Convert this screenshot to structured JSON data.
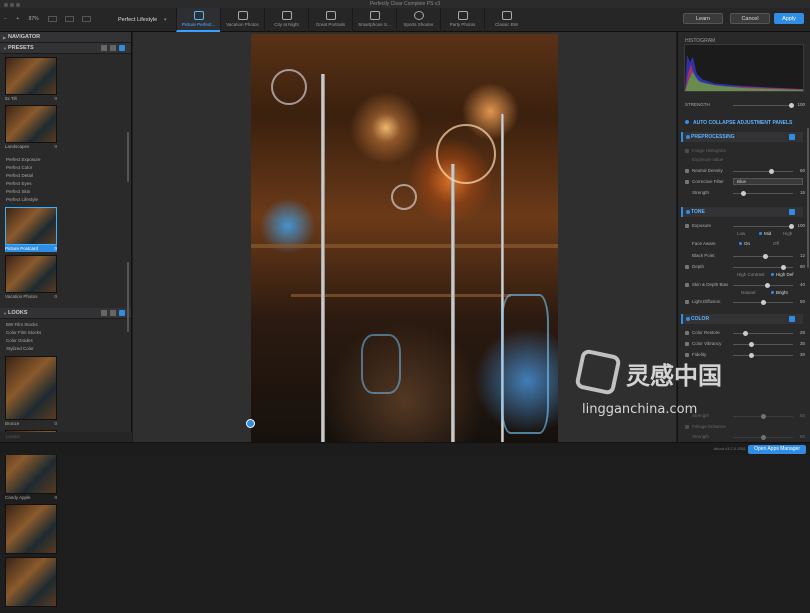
{
  "window": {
    "title": "Perfectly Clear Complete PS v3"
  },
  "toolbar": {
    "zoom_label": "87%",
    "preset": "Perfect Lifestyle",
    "categories": [
      {
        "label": "Picture Perfect...",
        "icon": "camera-icon"
      },
      {
        "label": "Vacation Photos",
        "icon": "beach-icon"
      },
      {
        "label": "City at Night",
        "icon": "city-icon"
      },
      {
        "label": "Great Portraits",
        "icon": "portrait-icon"
      },
      {
        "label": "Smartphone S...",
        "icon": "smartphone-icon"
      },
      {
        "label": "Sports Shooter",
        "icon": "soccer-ball-icon"
      },
      {
        "label": "Party Photos",
        "icon": "party-icon"
      },
      {
        "label": "Classic BW",
        "icon": "bw-icon"
      }
    ],
    "learn": "Learn",
    "cancel": "Cancel",
    "apply": "Apply"
  },
  "left": {
    "navigator": "NAVIGATOR",
    "presets": "PRESETS",
    "preset_thumbs_top": [
      {
        "label": "5x Tilt",
        "count": "0"
      },
      {
        "label": "Landscapes",
        "count": "0"
      }
    ],
    "preset_list": [
      "Perfect Exposure",
      "Perfect Color",
      "Perfect Detail",
      "Perfect Eyes",
      "Perfect Skin",
      "Perfect Lifestyle"
    ],
    "preset_thumbs": [
      {
        "label": "Picture Postcard",
        "count": "0"
      },
      {
        "label": "Vacation Photos",
        "count": "0"
      }
    ],
    "looks": "LOOKS",
    "looks_list": [
      "BW Film Stocks",
      "Color Film Stocks",
      "Color Grades",
      "Stylized Color"
    ],
    "looks_thumbs": [
      {
        "label": "Bronze",
        "count": "0"
      },
      {
        "label": "Candy Apple",
        "count": "0"
      }
    ],
    "footer": "LOOKS"
  },
  "right": {
    "histogram": "HISTOGRAM",
    "strength_label": "STRENGTH",
    "strength_value": "100",
    "auto_collapse": "AUTO COLLAPSE ADJUSTMENT PANELS",
    "preprocessing": {
      "title": "PREPROCESSING",
      "rows": [
        {
          "label": "Image Histogram",
          "value": ""
        },
        {
          "label": "Exposure Value",
          "value": ""
        },
        {
          "label": "Neutral Density",
          "value": "60"
        },
        {
          "label": "Corrective Filter",
          "dropdown": "Blue"
        },
        {
          "label": "Strength",
          "value": "15"
        }
      ]
    },
    "tone": {
      "title": "TONE",
      "exposure": {
        "label": "Exposure",
        "value": "100"
      },
      "exposure_opts": [
        "Low",
        "Mid",
        "High"
      ],
      "face_aware": {
        "label": "Face Aware",
        "on": "On",
        "off": "Off"
      },
      "black_point": {
        "label": "Black Point",
        "value": "12"
      },
      "depth": {
        "label": "Depth",
        "value": "80"
      },
      "depth_opts": [
        "High Contrast",
        "High Def"
      ],
      "skin_depth": {
        "label": "Skin & Depth Bias",
        "value": "40"
      },
      "skin_opts": [
        "Natural",
        "Bright"
      ],
      "light_diffusion": {
        "label": "Light Diffusion",
        "value": "50"
      }
    },
    "color": {
      "title": "COLOR",
      "rows": [
        {
          "label": "Color Restore",
          "value": "25"
        },
        {
          "label": "Color Vibrancy",
          "value": "30"
        },
        {
          "label": "Fidelity",
          "value": "30"
        }
      ],
      "strength": {
        "label": "Strength",
        "value": "50"
      },
      "foliage": {
        "label": "Foliage Enhance",
        "value": ""
      },
      "foliage_strength": {
        "label": "Strength",
        "value": "50"
      }
    }
  },
  "footer": {
    "version": "About v3.2.0.1551",
    "button": "Open Apps Manager"
  },
  "watermark": {
    "cn": "灵感中国",
    "en": "lingganchina.com"
  }
}
